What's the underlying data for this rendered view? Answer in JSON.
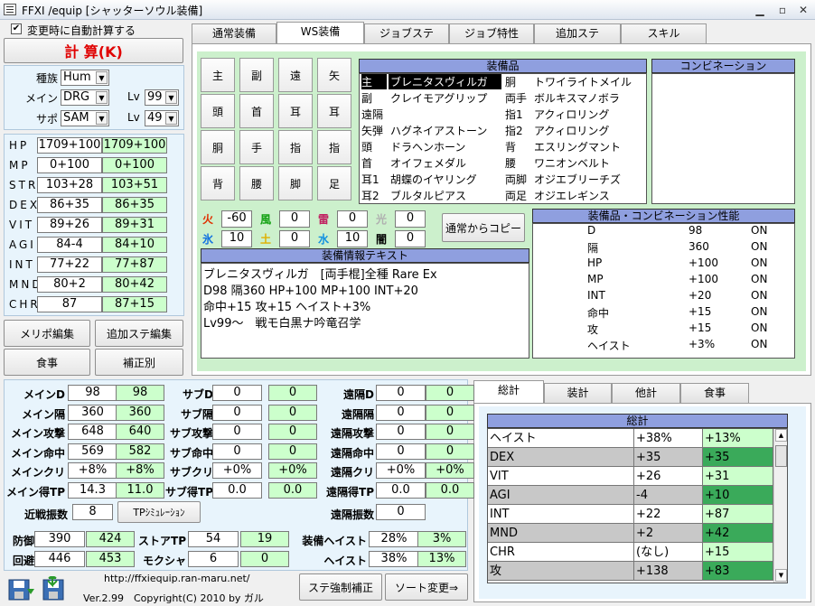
{
  "window": {
    "title": "FFXI /equip [シャッターソウル装備]"
  },
  "auto_calc": {
    "label": "変更時に自動計算する",
    "checked": true
  },
  "calc_button": "計 算(K)",
  "race": {
    "label": "種族",
    "value": "Hum"
  },
  "main_job": {
    "label": "メイン",
    "value": "DRG",
    "lv_label": "Lv",
    "lv": "99"
  },
  "sub_job": {
    "label": "サポ",
    "value": "SAM",
    "lv_label": "Lv",
    "lv": "49"
  },
  "stats": [
    {
      "name": "HP",
      "a": "1709+100",
      "b": "1709+100"
    },
    {
      "name": "MP",
      "a": "0+100",
      "b": "0+100"
    },
    {
      "name": "STR",
      "a": "103+28",
      "b": "103+51"
    },
    {
      "name": "DEX",
      "a": "86+35",
      "b": "86+35"
    },
    {
      "name": "VIT",
      "a": "89+26",
      "b": "89+31"
    },
    {
      "name": "AGI",
      "a": "84-4",
      "b": "84+10"
    },
    {
      "name": "INT",
      "a": "77+22",
      "b": "77+87"
    },
    {
      "name": "MND",
      "a": "80+2",
      "b": "80+42"
    },
    {
      "name": "CHR",
      "a": "87",
      "b": "87+15"
    }
  ],
  "left_buttons": {
    "merit": "メリポ編集",
    "add_stat": "追加ステ編集",
    "food": "食事",
    "correction": "補正別"
  },
  "tabs": [
    "通常装備",
    "WS装備",
    "ジョブステ",
    "ジョブ特性",
    "追加ステ",
    "スキル"
  ],
  "slots": [
    "主",
    "副",
    "遠",
    "矢",
    "頭",
    "首",
    "耳",
    "耳",
    "胴",
    "手",
    "指",
    "指",
    "背",
    "腰",
    "脚",
    "足"
  ],
  "equipment": {
    "header": "装備品",
    "left": [
      {
        "slot": "主",
        "name": "ブレニタスヴィルガ"
      },
      {
        "slot": "副",
        "name": "クレイモアグリップ"
      },
      {
        "slot": "遠隔",
        "name": ""
      },
      {
        "slot": "矢弾",
        "name": "ハグネイアストーン"
      },
      {
        "slot": "頭",
        "name": "ドラヘンホーン"
      },
      {
        "slot": "首",
        "name": "オイフェメダル"
      },
      {
        "slot": "耳1",
        "name": "胡蝶のイヤリング"
      },
      {
        "slot": "耳2",
        "name": "ブルタルピアス"
      }
    ],
    "right": [
      {
        "slot": "胴",
        "name": "トワイライトメイル"
      },
      {
        "slot": "両手",
        "name": "ボルキスマノボラ"
      },
      {
        "slot": "指1",
        "name": "アクィロリング"
      },
      {
        "slot": "指2",
        "name": "アクィロリング"
      },
      {
        "slot": "背",
        "name": "エスリングマント"
      },
      {
        "slot": "腰",
        "name": "ワニオンベルト"
      },
      {
        "slot": "両脚",
        "name": "オジエブリーチズ"
      },
      {
        "slot": "両足",
        "name": "オジエレギンス"
      }
    ]
  },
  "combination": {
    "header": "コンビネーション"
  },
  "elements": [
    {
      "name": "火",
      "value": "-60",
      "color": "#e03000"
    },
    {
      "name": "風",
      "value": "0",
      "color": "#10a010"
    },
    {
      "name": "雷",
      "value": "0",
      "color": "#c02060"
    },
    {
      "name": "光",
      "value": "0",
      "color": "#b0b0b0"
    },
    {
      "name": "氷",
      "value": "10",
      "color": "#1070e0"
    },
    {
      "name": "土",
      "value": "0",
      "color": "#e0b000"
    },
    {
      "name": "水",
      "value": "10",
      "color": "#1090e0"
    },
    {
      "name": "闇",
      "value": "0",
      "color": "#000000"
    }
  ],
  "copy_button": "通常からコピー",
  "equip_text": {
    "header": "装備情報テキスト",
    "lines": [
      "ブレニタスヴィルガ　[両手棍]全種 Rare Ex",
      "D98 隔360 HP+100 MP+100 INT+20",
      "命中+15 攻+15 ヘイスト+3%",
      "Lv99～　戦モ白黒ナ吟竜召学"
    ]
  },
  "perf": {
    "header": "装備品・コンビネーション性能",
    "rows": [
      {
        "k": "D",
        "v": "98",
        "s": "ON"
      },
      {
        "k": "隔",
        "v": "360",
        "s": "ON"
      },
      {
        "k": "HP",
        "v": "+100",
        "s": "ON"
      },
      {
        "k": "MP",
        "v": "+100",
        "s": "ON"
      },
      {
        "k": "INT",
        "v": "+20",
        "s": "ON"
      },
      {
        "k": "命中",
        "v": "+15",
        "s": "ON"
      },
      {
        "k": "攻",
        "v": "+15",
        "s": "ON"
      },
      {
        "k": "ヘイスト",
        "v": "+3%",
        "s": "ON"
      }
    ]
  },
  "combat": {
    "main": [
      {
        "l": "メインD",
        "a": "98",
        "b": "98"
      },
      {
        "l": "メイン隔",
        "a": "360",
        "b": "360"
      },
      {
        "l": "メイン攻撃",
        "a": "648",
        "b": "640"
      },
      {
        "l": "メイン命中",
        "a": "569",
        "b": "582"
      },
      {
        "l": "メインクリ",
        "a": "+8%",
        "b": "+8%"
      },
      {
        "l": "メイン得TP",
        "a": "14.3",
        "b": "11.0"
      }
    ],
    "sub": [
      {
        "l": "サブD",
        "a": "0",
        "b": "0"
      },
      {
        "l": "サブ隔",
        "a": "0",
        "b": "0"
      },
      {
        "l": "サブ攻撃",
        "a": "0",
        "b": "0"
      },
      {
        "l": "サブ命中",
        "a": "0",
        "b": "0"
      },
      {
        "l": "サブクリ",
        "a": "+0%",
        "b": "+0%"
      },
      {
        "l": "サブ得TP",
        "a": "0.0",
        "b": "0.0"
      }
    ],
    "ranged": [
      {
        "l": "遠隔D",
        "a": "0",
        "b": "0"
      },
      {
        "l": "遠隔隔",
        "a": "0",
        "b": "0"
      },
      {
        "l": "遠隔攻撃",
        "a": "0",
        "b": "0"
      },
      {
        "l": "遠隔命中",
        "a": "0",
        "b": "0"
      },
      {
        "l": "遠隔クリ",
        "a": "+0%",
        "b": "+0%"
      },
      {
        "l": "遠隔得TP",
        "a": "0.0",
        "b": "0.0"
      }
    ],
    "melee_hits": {
      "label": "近戦振数",
      "value": "8"
    },
    "ranged_hits": {
      "label": "遠隔振数",
      "value": "0"
    },
    "tp_sim": "TPｼﾐｭﾚｰｼｮﾝ",
    "defense": {
      "label": "防御",
      "a": "390",
      "b": "424"
    },
    "evasion": {
      "label": "回避",
      "a": "446",
      "b": "453"
    },
    "store_tp": {
      "label": "ストアTP",
      "a": "54",
      "b": "19"
    },
    "mokusha": {
      "label": "モクシャ",
      "a": "6",
      "b": "0"
    },
    "equip_haste": {
      "label": "装備ヘイスト",
      "a": "28%",
      "b": "3%"
    },
    "haste": {
      "label": "ヘイスト",
      "a": "38%",
      "b": "13%"
    }
  },
  "footer": {
    "url": "http://ffxiequip.ran-maru.net/",
    "version": "Ver.2.99　Copyright(C) 2010 by ガル",
    "force_button": "ステ強制補正",
    "sort_button": "ソート変更⇒"
  },
  "summary_tabs": [
    "総計",
    "装計",
    "他計",
    "食事"
  ],
  "summary": {
    "header": "総計",
    "rows": [
      {
        "k": "ヘイスト",
        "a": "+38%",
        "b": "+13%"
      },
      {
        "k": "DEX",
        "a": "+35",
        "b": "+35"
      },
      {
        "k": "VIT",
        "a": "+26",
        "b": "+31"
      },
      {
        "k": "AGI",
        "a": "-4",
        "b": "+10"
      },
      {
        "k": "INT",
        "a": "+22",
        "b": "+87"
      },
      {
        "k": "MND",
        "a": "+2",
        "b": "+42"
      },
      {
        "k": "CHR",
        "a": "(なし)",
        "b": "+15"
      },
      {
        "k": "攻",
        "a": "+138",
        "b": "+83"
      }
    ]
  }
}
